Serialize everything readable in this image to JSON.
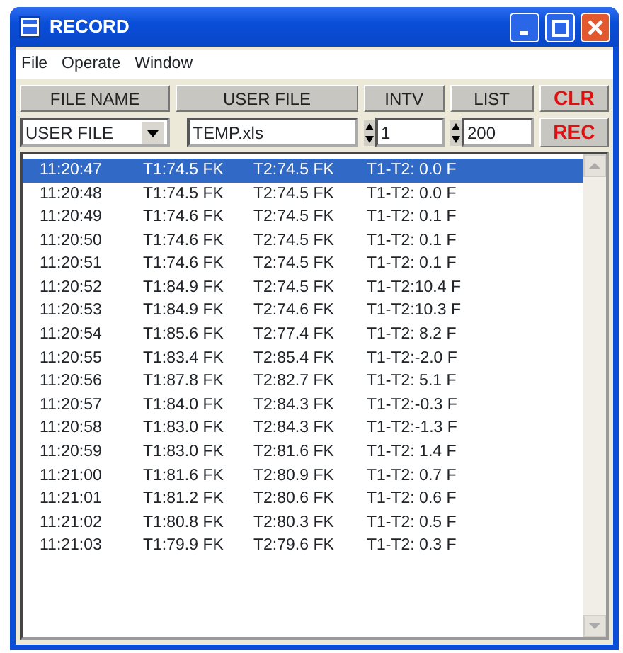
{
  "window": {
    "title": "RECORD"
  },
  "menu": [
    {
      "label": "File"
    },
    {
      "label": "Operate"
    },
    {
      "label": "Window"
    }
  ],
  "headers": [
    "FILE NAME",
    "USER FILE",
    "INTV",
    "LIST"
  ],
  "clear_button": "CLR",
  "record_button": "REC",
  "file_name_select": {
    "value": "USER FILE"
  },
  "user_file_field": {
    "value": "TEMP.xls"
  },
  "interval_spinner": {
    "value": "1"
  },
  "list_spinner": {
    "value": "200"
  },
  "log": [
    {
      "time": "11:20:47",
      "t1": "T1:74.5 FK",
      "t2": "T2:74.5 FK",
      "diff": "T1-T2: 0.0 F",
      "selected": true
    },
    {
      "time": "11:20:48",
      "t1": "T1:74.5 FK",
      "t2": "T2:74.5 FK",
      "diff": "T1-T2: 0.0 F",
      "selected": false
    },
    {
      "time": "11:20:49",
      "t1": "T1:74.6 FK",
      "t2": "T2:74.5 FK",
      "diff": "T1-T2: 0.1 F",
      "selected": false
    },
    {
      "time": "11:20:50",
      "t1": "T1:74.6 FK",
      "t2": "T2:74.5 FK",
      "diff": "T1-T2: 0.1 F",
      "selected": false
    },
    {
      "time": "11:20:51",
      "t1": "T1:74.6 FK",
      "t2": "T2:74.5 FK",
      "diff": "T1-T2: 0.1 F",
      "selected": false
    },
    {
      "time": "11:20:52",
      "t1": "T1:84.9 FK",
      "t2": "T2:74.5 FK",
      "diff": "T1-T2:10.4 F",
      "selected": false
    },
    {
      "time": "11:20:53",
      "t1": "T1:84.9 FK",
      "t2": "T2:74.6 FK",
      "diff": "T1-T2:10.3 F",
      "selected": false
    },
    {
      "time": "11:20:54",
      "t1": "T1:85.6 FK",
      "t2": "T2:77.4 FK",
      "diff": "T1-T2: 8.2 F",
      "selected": false
    },
    {
      "time": "11:20:55",
      "t1": "T1:83.4 FK",
      "t2": "T2:85.4 FK",
      "diff": "T1-T2:-2.0 F",
      "selected": false
    },
    {
      "time": "11:20:56",
      "t1": "T1:87.8 FK",
      "t2": "T2:82.7 FK",
      "diff": "T1-T2: 5.1 F",
      "selected": false
    },
    {
      "time": "11:20:57",
      "t1": "T1:84.0 FK",
      "t2": "T2:84.3 FK",
      "diff": "T1-T2:-0.3 F",
      "selected": false
    },
    {
      "time": "11:20:58",
      "t1": "T1:83.0 FK",
      "t2": "T2:84.3 FK",
      "diff": "T1-T2:-1.3 F",
      "selected": false
    },
    {
      "time": "11:20:59",
      "t1": "T1:83.0 FK",
      "t2": "T2:81.6 FK",
      "diff": "T1-T2: 1.4 F",
      "selected": false
    },
    {
      "time": "11:21:00",
      "t1": "T1:81.6 FK",
      "t2": "T2:80.9 FK",
      "diff": "T1-T2: 0.7 F",
      "selected": false
    },
    {
      "time": "11:21:01",
      "t1": "T1:81.2 FK",
      "t2": "T2:80.6 FK",
      "diff": "T1-T2: 0.6 F",
      "selected": false
    },
    {
      "time": "11:21:02",
      "t1": "T1:80.8 FK",
      "t2": "T2:80.3 FK",
      "diff": "T1-T2: 0.5 F",
      "selected": false
    },
    {
      "time": "11:21:03",
      "t1": "T1:79.9 FK",
      "t2": "T2:79.6 FK",
      "diff": "T1-T2: 0.3 F",
      "selected": false
    }
  ]
}
